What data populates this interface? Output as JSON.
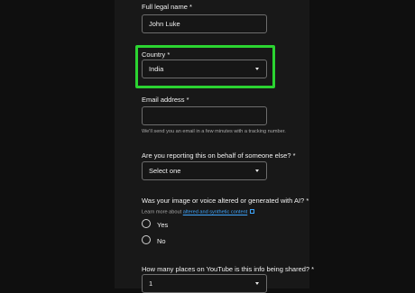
{
  "form": {
    "legal_name": {
      "label": "Full legal name *",
      "value": "John Luke"
    },
    "country": {
      "label": "Country *",
      "value": "India"
    },
    "email": {
      "label": "Email address *",
      "value": "",
      "hint": "We'll send you an email in a few minutes with a tracking number."
    },
    "on_behalf": {
      "label": "Are you reporting this on behalf of someone else? *",
      "value": "Select one"
    },
    "ai_altered": {
      "label": "Was your image or voice altered or generated with AI? *",
      "learn_more_prefix": "Learn more about ",
      "learn_more_link": "altered and synthetic content",
      "options": [
        "Yes",
        "No"
      ]
    },
    "places": {
      "label": "How many places on YouTube is this info being shared? *",
      "value": "1"
    }
  },
  "colors": {
    "highlight": "#2bd431",
    "link": "#3ea6ff",
    "background": "#181818"
  },
  "icons": {
    "dropdown": "chevron-down-icon",
    "external_link": "external-link-icon"
  }
}
